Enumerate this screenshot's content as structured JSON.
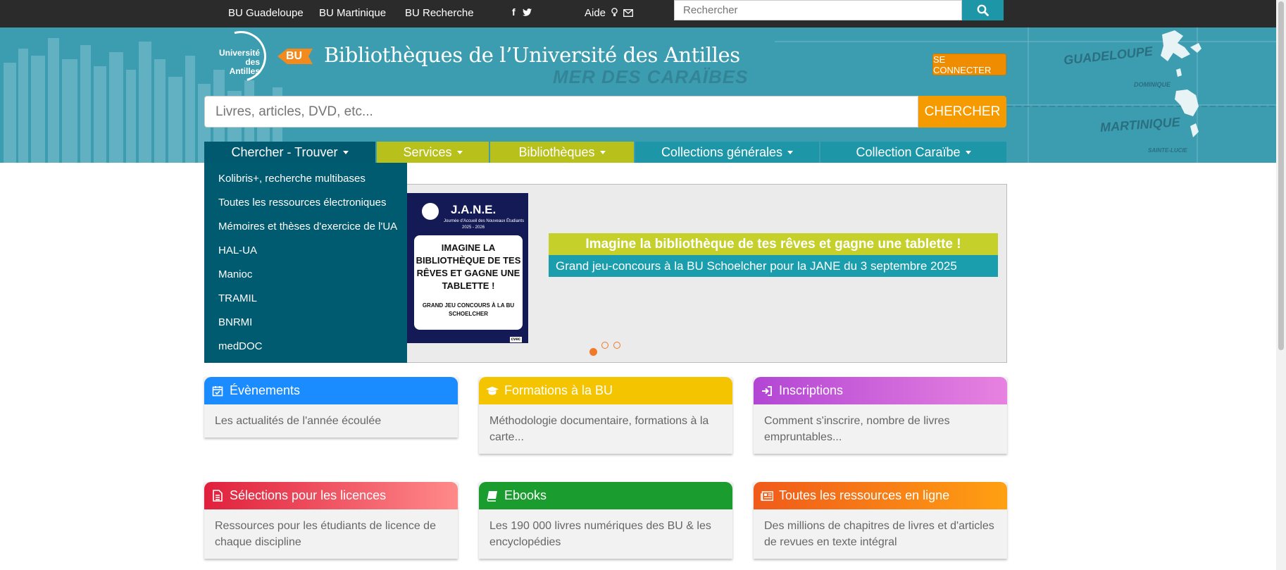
{
  "topbar": {
    "links": [
      "BU Guadeloupe",
      "BU Martinique",
      "BU Recherche"
    ],
    "social": "f",
    "aide_label": "Aide",
    "search_placeholder": "Rechercher"
  },
  "header": {
    "site_title": "Bibliothèques de l’Université des Antilles",
    "logo_ua_text": "Université des Antilles",
    "logo_bu_text": "BU",
    "map_sea": "MER DES CARAÏBES",
    "map_labels": [
      "GUADELOUPE",
      "DOMINIQUE",
      "MARTINIQUE",
      "SAINTE-LUCIE"
    ],
    "connect_label": "SE CONNECTER",
    "main_search_placeholder": "Livres, articles, DVD, etc...",
    "main_search_button": "CHERCHER"
  },
  "nav": {
    "items": [
      {
        "label": "Chercher - Trouver",
        "color": "#00596f"
      },
      {
        "label": "Services",
        "color": "#b8c01b"
      },
      {
        "label": "Bibliothèques",
        "color": "#b8c01b"
      },
      {
        "label": "Collections générales",
        "color": "#1d96a7"
      },
      {
        "label": "Collection Caraïbe",
        "color": "#1d96a7"
      }
    ]
  },
  "dropdown": {
    "items": [
      "Kolibris+, recherche multibases",
      "Toutes les ressources électroniques",
      "Mémoires et thèses d'exercice de l'UA",
      "HAL-UA",
      "Manioc",
      "TRAMIL",
      "BNRMI",
      "medDOC"
    ]
  },
  "slider": {
    "poster_title": "J.A.N.E.",
    "poster_sub": "Journée d’Accueil des Nouveaux Étudiants",
    "poster_year": "2025 - 2026",
    "poster_big": "IMAGINE LA BIBLIOTHÈQUE DE TES RÊVES ET GAGNE UNE TABLETTE !",
    "poster_small": "GRAND JEU CONCOURS À LA BU SCHOELCHER",
    "poster_footer": "cvec",
    "banner_title": "Imagine la bibliothèque de tes rêves et gagne une tablette !",
    "banner_subtitle": "Grand jeu-concours à la BU Schoelcher pour la JANE du 3 septembre 2025",
    "active_slide": 1,
    "slide_count": 3
  },
  "cards": [
    {
      "title": "Évènements",
      "body": "Les actualités de l'année écoulée",
      "icon": "calendar-check-icon",
      "color": "#1a8cff"
    },
    {
      "title": "Formations à la BU",
      "body": "Méthodologie documentaire, formations à la carte...",
      "icon": "graduation-cap-icon",
      "color": "#f5c400"
    },
    {
      "title": "Inscriptions",
      "body": "Comment s'inscrire, nombre de livres empruntables...",
      "icon": "sign-in-icon",
      "color": "#c55ad6"
    },
    {
      "title": "Sélections pour les licences",
      "body": "Ressources pour les étudiants de licence de chaque discipline",
      "icon": "file-text-icon",
      "color": "#e8324a"
    },
    {
      "title": "Ebooks",
      "body": "Les 190 000 livres numériques des BU & les encyclopédies",
      "icon": "book-icon",
      "color": "#1a9c2e"
    },
    {
      "title": "Toutes les ressources en ligne",
      "body": "Des millions de chapitres de livres et d'articles de revues en texte intégral",
      "icon": "newspaper-icon",
      "color": "#f26a1b"
    }
  ]
}
